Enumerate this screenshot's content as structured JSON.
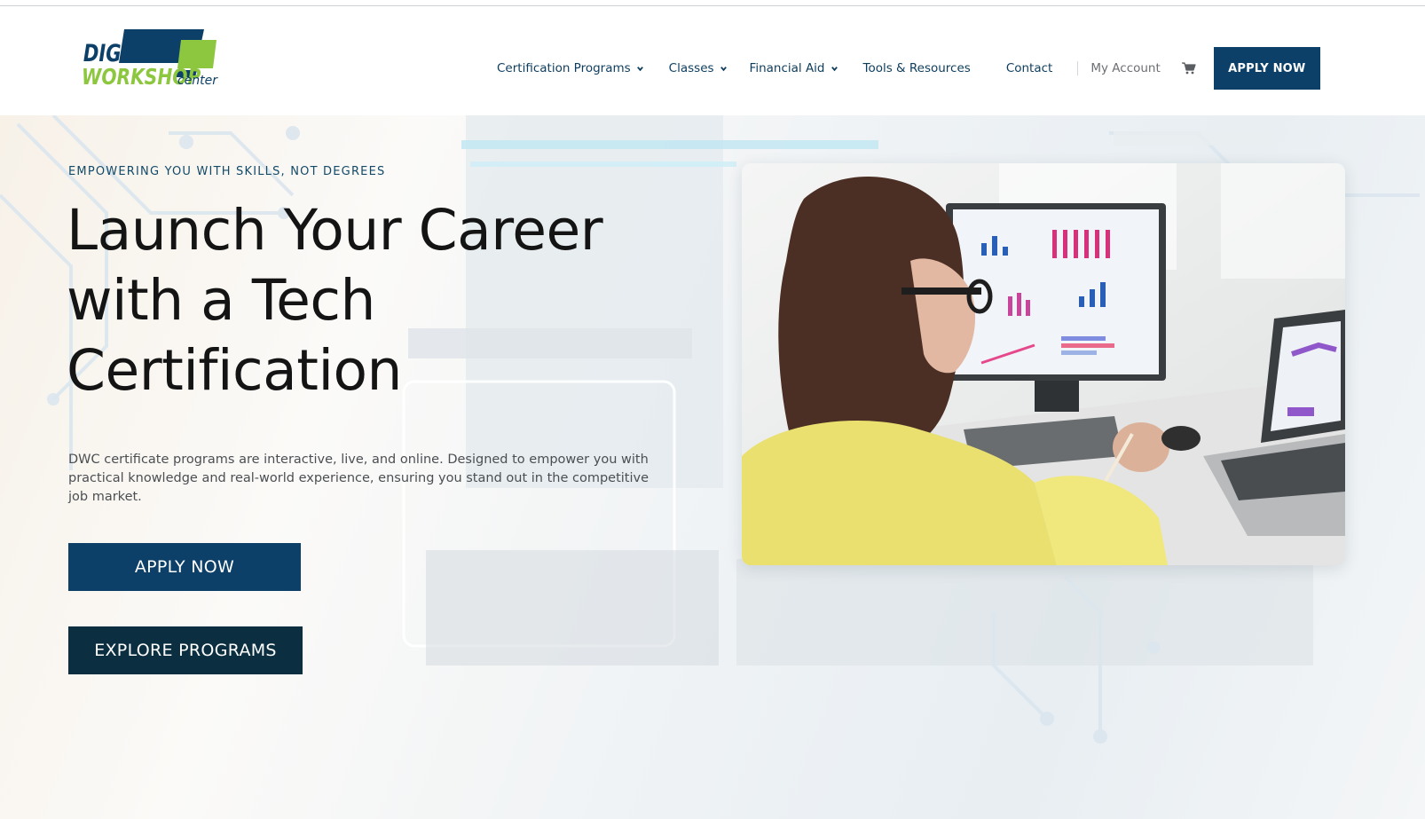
{
  "header": {
    "logo": {
      "line1": "DIGITAL",
      "line2": "WORKSHOP",
      "line3": "center"
    },
    "nav": [
      {
        "label": "Certification Programs",
        "has_dropdown": true
      },
      {
        "label": "Classes",
        "has_dropdown": true
      },
      {
        "label": "Financial Aid",
        "has_dropdown": true
      },
      {
        "label": "Tools & Resources",
        "has_dropdown": false
      },
      {
        "label": "Contact",
        "has_dropdown": false
      }
    ],
    "account_label": "My Account",
    "cart_icon": "cart-icon",
    "apply_label": "APPLY NOW"
  },
  "hero": {
    "eyebrow": "EMPOWERING YOU WITH SKILLS, NOT DEGREES",
    "headline": "Launch Your Career with a Tech Certification",
    "lead": "DWC certificate programs are interactive, live, and online.  Designed to empower you with practical knowledge and real-world experience, ensuring you stand out in the competitive job market.",
    "apply_label": "APPLY NOW",
    "explore_label": "EXPLORE PROGRAMS"
  },
  "colors": {
    "brand_navy": "#0d4068",
    "dark_teal": "#0b2f40",
    "logo_green": "#8dc63f",
    "nav_text": "#0d3d5e"
  }
}
